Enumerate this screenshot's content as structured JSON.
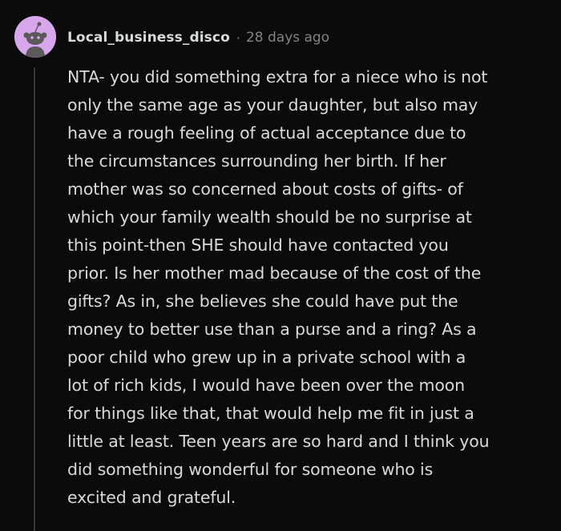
{
  "comment": {
    "avatar": {
      "icon": "snoo-avatar-icon",
      "background": "#d8a6ec"
    },
    "author": "Local_business_disco",
    "separator": "·",
    "timestamp": "28 days ago",
    "body_lines": [
      "NTA- you did something extra for a niece who is not",
      "only the same age as your daughter, but also may",
      "have a rough feeling of actual acceptance due to",
      "the circumstances surrounding her birth. If her",
      "mother was so concerned about costs of gifts- of",
      "which your family wealth should be no surprise at",
      "this point-then SHE should have contacted you",
      "prior. Is her mother mad because of the cost of the",
      "gifts? As in, she believes she could have put the",
      "money to better use than a purse and a ring? As a",
      "poor child who grew up in a private school with a",
      "lot of rich kids, I would have been over the moon",
      "for things like that, that would help me fit in just a",
      "little at least. Teen years are so hard and I think you",
      "did something wonderful for someone who is",
      "excited and grateful."
    ]
  },
  "colors": {
    "background": "#0b0b0b",
    "text": "#d7dadc",
    "meta": "#818384",
    "thread_line": "#343536",
    "avatar_bg": "#d8a6ec"
  }
}
